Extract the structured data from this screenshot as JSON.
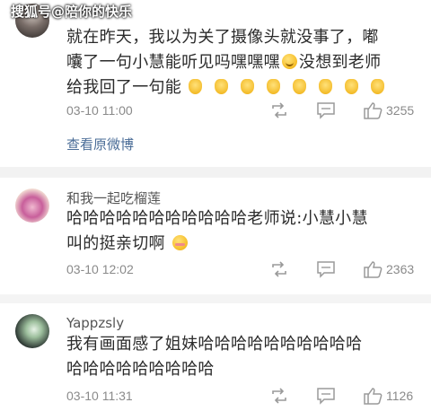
{
  "watermark": "搜狐号@陪你的快乐",
  "comments": [
    {
      "username": "",
      "text_lines": [
        "就在昨天，我以为关了摄像头就没事了，嘟",
        "囔了一句小慧能听见吗嘿嘿嘿",
        "没想到老师",
        "给我回了一句能"
      ],
      "time": "03-10 11:00",
      "likes": "3255",
      "view_original": "查看原微博"
    },
    {
      "username": "和我一起吃榴莲",
      "text_lines": [
        "哈哈哈哈哈哈哈哈哈哈哈老师说:小慧小慧",
        "叫的挺亲切啊"
      ],
      "time": "03-10 12:02",
      "likes": "2363"
    },
    {
      "username": "Yappzsly",
      "text_lines": [
        "我有画面感了姐妹哈哈哈哈哈哈哈哈哈哈",
        "哈哈哈哈哈哈哈哈哈"
      ],
      "time": "03-10 11:31",
      "likes": "1126"
    }
  ],
  "icons": {
    "repost": "repost-icon",
    "comment": "comment-icon",
    "like": "thumbs-up-icon",
    "smile_emoji": "smile-emoji",
    "clap_emoji": "clap-emoji",
    "blush_emoji": "blush-emoji"
  },
  "colors": {
    "link": "#4a6c97",
    "meta": "#8a8a8a",
    "separator": "#f2f2f2"
  }
}
